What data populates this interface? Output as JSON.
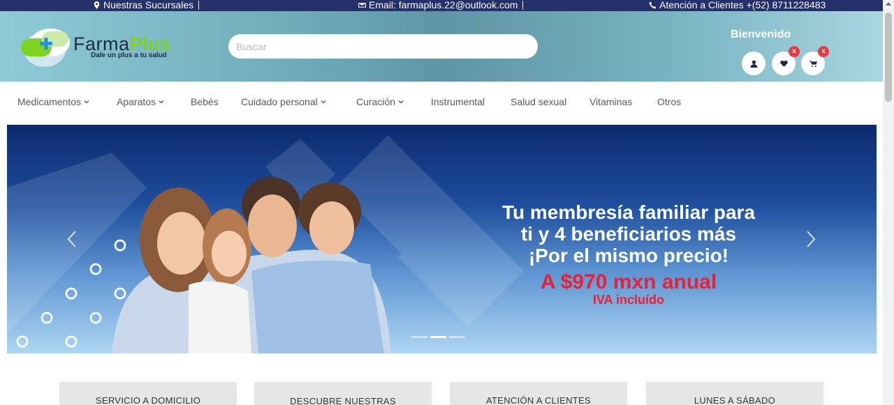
{
  "topbar": {
    "branches": "Nuestras Sucursales",
    "email": "Email: farmaplus.22@outlook.com",
    "support": "Atención a Clientes +(52) 8711228483"
  },
  "logo": {
    "name_part1": "Farma",
    "name_part2": "Plus",
    "tagline": "Dale un plus a tu salud"
  },
  "search": {
    "placeholder": "Buscar"
  },
  "header": {
    "welcome": "Bienvenido",
    "wishlist_badge": "x",
    "cart_badge": "x"
  },
  "nav": {
    "items": [
      {
        "label": "Medicamentos",
        "dropdown": true
      },
      {
        "label": "Aparatos",
        "dropdown": true
      },
      {
        "label": "Bebés",
        "dropdown": false
      },
      {
        "label": "Cuidado personal",
        "dropdown": true
      },
      {
        "label": "Curación",
        "dropdown": true
      },
      {
        "label": "Instrumental",
        "dropdown": false
      },
      {
        "label": "Salud sexual",
        "dropdown": false
      },
      {
        "label": "Vitaminas",
        "dropdown": false
      },
      {
        "label": "Otros",
        "dropdown": false
      }
    ]
  },
  "hero": {
    "line1": "Tu membresía familiar para",
    "line2": "ti y 4 beneficiarios más",
    "line3": "¡Por el mismo precio!",
    "price": "A $970 mxn anual",
    "tax": "IVA incluído",
    "slides": 3,
    "active_slide": 2
  },
  "cards": [
    {
      "title": "SERVICIO A DOMICILIO"
    },
    {
      "title": "DESCUBRE NUESTRAS"
    },
    {
      "title": "ATENCIÓN A CLIENTES"
    },
    {
      "title": "LUNES A SÁBADO"
    }
  ],
  "colors": {
    "topbar": "#25306b",
    "accent_green": "#7ed321",
    "price_red": "#e8203a",
    "badge_red": "#e63946"
  },
  "icons": {
    "branches": "map-pin-icon",
    "email": "envelope-icon",
    "support": "phone-icon",
    "user": "user-icon",
    "wishlist": "heart-icon",
    "cart": "cart-icon"
  }
}
